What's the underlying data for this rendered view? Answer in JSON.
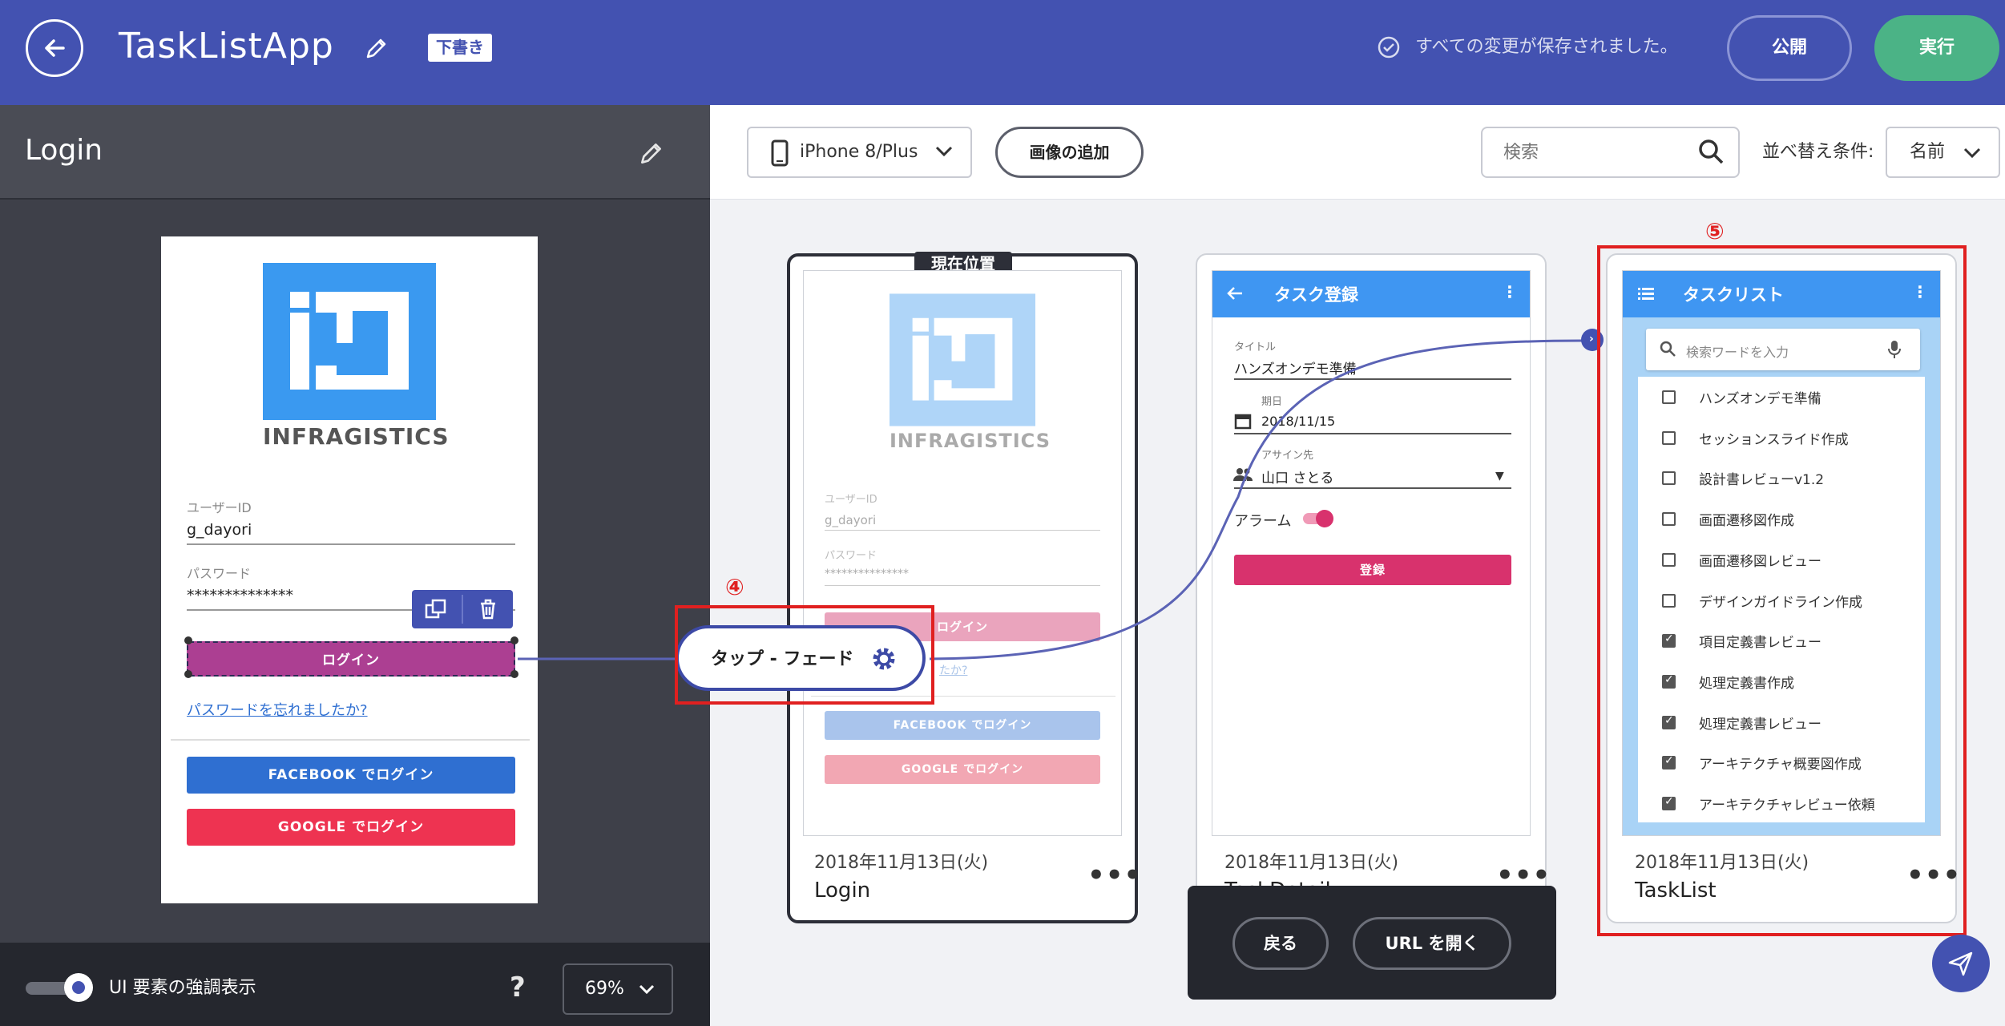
{
  "header": {
    "title": "TaskListApp",
    "draft_badge": "下書き",
    "saved_status": "すべての変更が保存されました。",
    "publish_label": "公開",
    "run_label": "実行"
  },
  "left_panel": {
    "screen_name": "Login",
    "highlight_label": "UI 要素の強調表示",
    "help": "?",
    "zoom": "69%",
    "login": {
      "logo_text": "INFRAGISTICS",
      "user_id_label": "ユーザーID",
      "user_id_value": "g_dayori",
      "password_label": "パスワード",
      "password_value": "**************",
      "login_button": "ログイン",
      "forgot_link": "パスワードを忘れましたか?",
      "facebook_button": "FACEBOOK でログイン",
      "google_button": "GOOGLE でログイン"
    }
  },
  "toolbar": {
    "device": "iPhone 8/Plus",
    "add_image": "画像の追加",
    "search_placeholder": "検索",
    "sort_label": "並べ替え条件:",
    "sort_value": "名前"
  },
  "transition": {
    "label": "タップ - フェード",
    "number_4": "④",
    "number_5": "⑤"
  },
  "cards": [
    {
      "badge": "現在位置",
      "date": "2018年11月13日(火)",
      "name": "Login",
      "mini": {
        "logo_text": "INFRAGISTICS",
        "user_label": "ユーザーID",
        "user_value": "g_dayori",
        "pass_label": "パスワード",
        "pass_value": "***************",
        "login": "ログイン",
        "forgot": "たか?",
        "facebook": "FACEBOOK でログイン",
        "google": "GOOGLE でログイン"
      }
    },
    {
      "date": "2018年11月13日(火)",
      "name_partial": "TaskDetail",
      "mini": {
        "title": "タスク登録",
        "title_label": "タイトル",
        "title_value": "ハンズオンデモ準備",
        "due_label": "期日",
        "due_value": "2018/11/15",
        "assignee_label": "アサイン先",
        "assignee_value": "山口 さとる",
        "alarm_label": "アラーム",
        "register": "登録"
      }
    },
    {
      "date": "2018年11月13日(火)",
      "name": "TaskList",
      "mini": {
        "title": "タスクリスト",
        "search_placeholder": "検索ワードを入力",
        "items": [
          {
            "label": "ハンズオンデモ準備",
            "checked": false
          },
          {
            "label": "セッションスライド作成",
            "checked": false
          },
          {
            "label": "設計書レビューv1.2",
            "checked": false
          },
          {
            "label": "画面遷移図作成",
            "checked": false
          },
          {
            "label": "画面遷移図レビュー",
            "checked": false
          },
          {
            "label": "デザインガイドライン作成",
            "checked": false
          },
          {
            "label": "項目定義書レビュー",
            "checked": true
          },
          {
            "label": "処理定義書作成",
            "checked": true
          },
          {
            "label": "処理定義書レビュー",
            "checked": true
          },
          {
            "label": "アーキテクチャ概要図作成",
            "checked": true
          },
          {
            "label": "アーキテクチャレビュー依頼",
            "checked": true
          }
        ]
      }
    }
  ],
  "popup": {
    "back": "戻る",
    "open_url": "URL を開く"
  },
  "colors": {
    "header": "#4352b1",
    "run": "#4bb386",
    "accent_pink": "#d8326d",
    "login_button": "#ac3f92",
    "facebook": "#2f6fd1",
    "google": "#ee3351",
    "annotation_red": "#e02020",
    "mini_appbar": "#3f96f2"
  }
}
